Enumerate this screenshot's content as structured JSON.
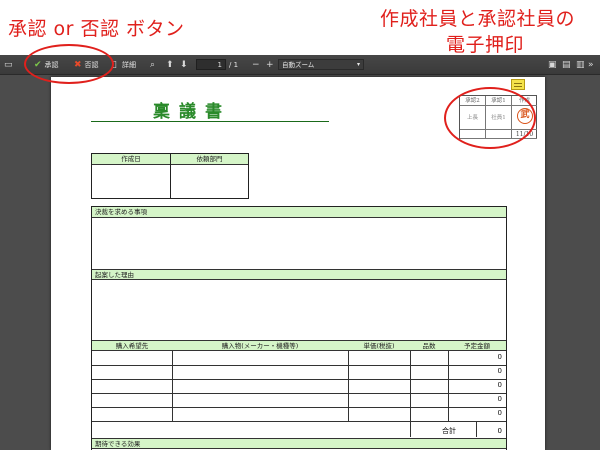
{
  "annotations": {
    "left_label": "承認 or 否認 ボタン",
    "right_label_line1": "作成社員と承認社員の",
    "right_label_line2": "電子押印"
  },
  "toolbar": {
    "approve_label": "承認",
    "reject_label": "否認",
    "detail_label": "詳細",
    "page_current": "1",
    "page_total": "/ 1",
    "zoom_value": "自動ズーム"
  },
  "document": {
    "title": "稟議書",
    "stamp": {
      "headers": [
        "承認2",
        "承認1",
        "作成"
      ],
      "names": [
        "上長",
        "社員1"
      ],
      "seal_text": "武",
      "date": "11/10"
    },
    "info_headers": [
      "作成日",
      "依頼部門"
    ],
    "sections": {
      "decision": "決裁を求める事項",
      "reason": "起案した理由",
      "effect": "期待できる効果"
    },
    "purchase_table": {
      "headers": [
        "購入希望先",
        "購入物(メーカー・機種等)",
        "単価(税抜)",
        "品数",
        "予定金額"
      ],
      "amounts": [
        "0",
        "0",
        "0",
        "0",
        "0"
      ],
      "total_label": "合計",
      "total_value": "0"
    }
  },
  "colors": {
    "annotation_red": "#e0201c",
    "title_green": "#2a8a2a",
    "header_green": "#d5f5c8",
    "seal_orange": "#d9541a"
  }
}
